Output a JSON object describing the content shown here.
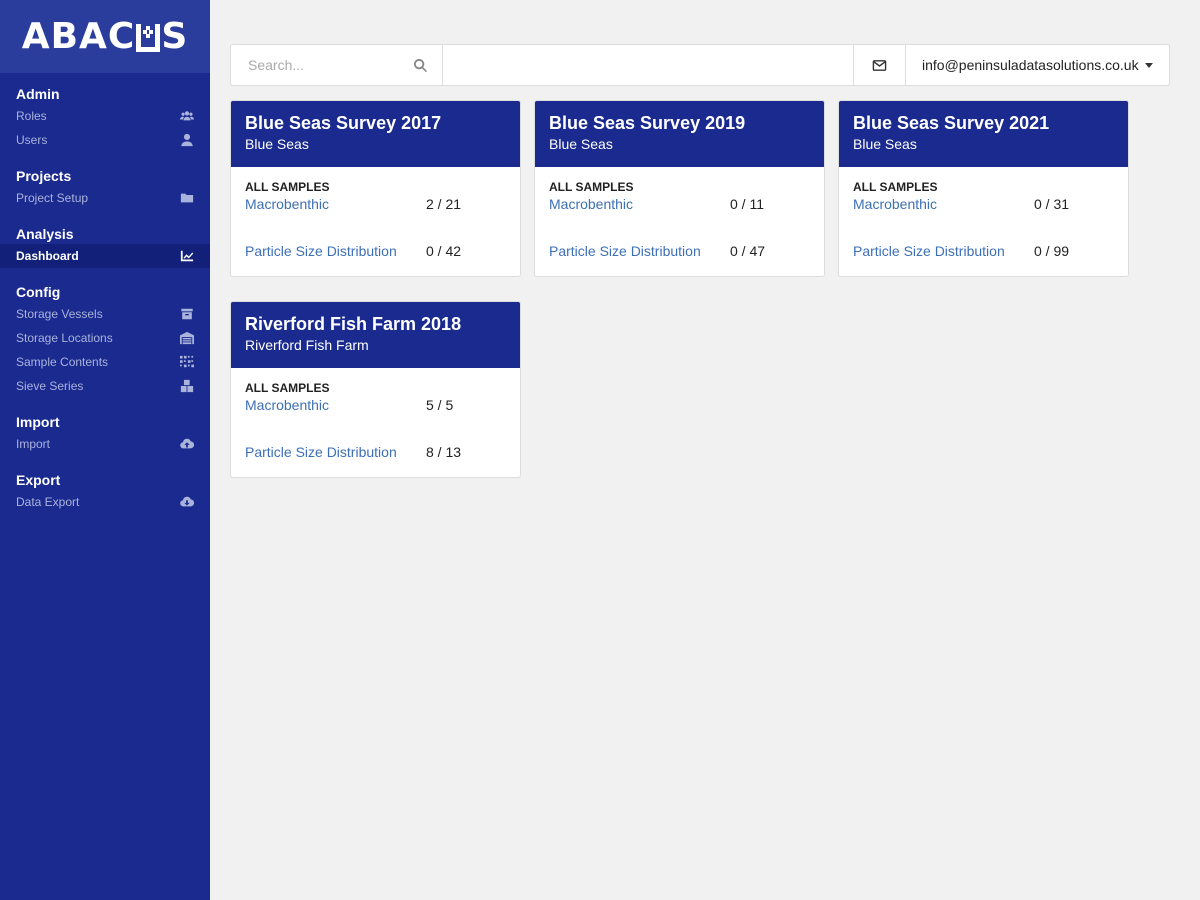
{
  "app": {
    "logo_left": "ABAC",
    "logo_right": "S"
  },
  "sidebar": {
    "sections": [
      {
        "title": "Admin",
        "items": [
          {
            "label": "Roles",
            "icon": "users-group-icon"
          },
          {
            "label": "Users",
            "icon": "user-icon"
          }
        ]
      },
      {
        "title": "Projects",
        "items": [
          {
            "label": "Project Setup",
            "icon": "folder-icon"
          }
        ]
      },
      {
        "title": "Analysis",
        "items": [
          {
            "label": "Dashboard",
            "icon": "chart-line-icon",
            "active": true
          }
        ]
      },
      {
        "title": "Config",
        "items": [
          {
            "label": "Storage Vessels",
            "icon": "archive-icon"
          },
          {
            "label": "Storage Locations",
            "icon": "warehouse-icon"
          },
          {
            "label": "Sample Contents",
            "icon": "grid-dots-icon"
          },
          {
            "label": "Sieve Series",
            "icon": "boxes-icon"
          }
        ]
      },
      {
        "title": "Import",
        "items": [
          {
            "label": "Import",
            "icon": "cloud-upload-icon"
          }
        ]
      },
      {
        "title": "Export",
        "items": [
          {
            "label": "Data Export",
            "icon": "cloud-download-icon"
          }
        ]
      }
    ]
  },
  "topbar": {
    "search_placeholder": "Search...",
    "user_email": "info@peninsuladatasolutions.co.uk"
  },
  "cards": [
    {
      "title": "Blue Seas Survey 2017",
      "subtitle": "Blue Seas",
      "samples_label": "ALL SAMPLES",
      "rows": [
        {
          "label": "Macrobenthic",
          "count": "2 / 21"
        },
        {
          "label": "Particle Size Distribution",
          "count": "0 / 42"
        }
      ]
    },
    {
      "title": "Blue Seas Survey 2019",
      "subtitle": "Blue Seas",
      "samples_label": "ALL SAMPLES",
      "rows": [
        {
          "label": "Macrobenthic",
          "count": "0 / 11"
        },
        {
          "label": "Particle Size Distribution",
          "count": "0 / 47"
        }
      ]
    },
    {
      "title": "Blue Seas Survey 2021",
      "subtitle": "Blue Seas",
      "samples_label": "ALL SAMPLES",
      "rows": [
        {
          "label": "Macrobenthic",
          "count": "0 / 31"
        },
        {
          "label": "Particle Size Distribution",
          "count": "0 / 99"
        }
      ]
    },
    {
      "title": "Riverford Fish Farm 2018",
      "subtitle": "Riverford Fish Farm",
      "samples_label": "ALL SAMPLES",
      "rows": [
        {
          "label": "Macrobenthic",
          "count": "5 / 5"
        },
        {
          "label": "Particle Size Distribution",
          "count": "8 / 13"
        }
      ]
    }
  ],
  "colors": {
    "primary": "#1a2a8f",
    "logo_bg": "#2a3c9c",
    "active_item": "#13207a",
    "link": "#3d6fb6",
    "background": "#f1f1f1"
  }
}
